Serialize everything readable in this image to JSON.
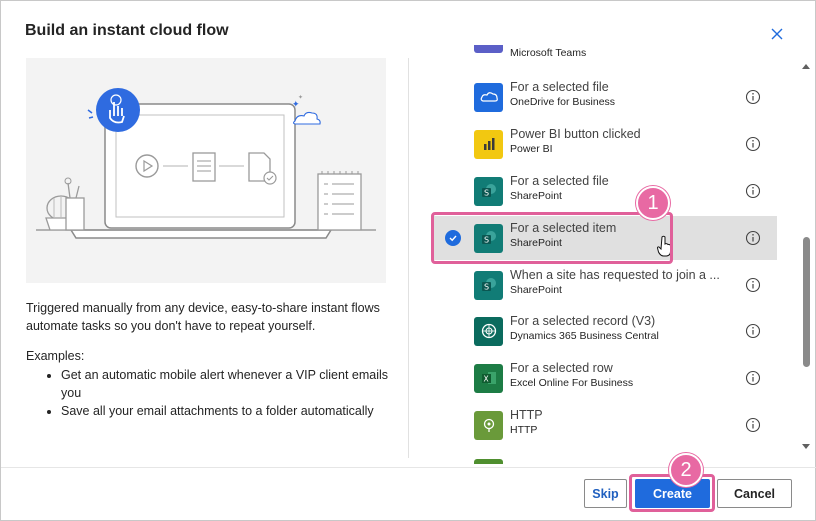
{
  "dialog": {
    "title": "Build an instant cloud flow",
    "close_icon": "close-icon"
  },
  "left": {
    "description": "Triggered manually from any device, easy-to-share instant flows automate tasks so you don't have to repeat yourself.",
    "examples_title": "Examples:",
    "examples": [
      "Get an automatic mobile alert whenever a VIP client emails you",
      "Save all your email attachments to a folder automatically"
    ]
  },
  "triggers": [
    {
      "title": "",
      "subtitle": "Microsoft Teams",
      "icon": "teams-icon",
      "color": "#5b5fc7",
      "partial": true
    },
    {
      "title": "For a selected file",
      "subtitle": "OneDrive for Business",
      "icon": "onedrive-icon",
      "color": "#1f6bdd"
    },
    {
      "title": "Power BI button clicked",
      "subtitle": "Power BI",
      "icon": "powerbi-icon",
      "color": "#f2c811"
    },
    {
      "title": "For a selected file",
      "subtitle": "SharePoint",
      "icon": "sharepoint-icon",
      "color": "#117c76"
    },
    {
      "title": "For a selected item",
      "subtitle": "SharePoint",
      "icon": "sharepoint-icon",
      "color": "#117c76",
      "selected": true
    },
    {
      "title": "When a site has requested to join a ...",
      "subtitle": "SharePoint",
      "icon": "sharepoint-icon",
      "color": "#117c76"
    },
    {
      "title": "For a selected record (V3)",
      "subtitle": "Dynamics 365 Business Central",
      "icon": "dynamics-icon",
      "color": "#0b6b5e"
    },
    {
      "title": "For a selected row",
      "subtitle": "Excel Online For Business",
      "icon": "excel-icon",
      "color": "#1d7c45"
    },
    {
      "title": "HTTP",
      "subtitle": "HTTP",
      "icon": "http-icon",
      "color": "#6a9a3a"
    },
    {
      "title": "",
      "subtitle": "",
      "icon": "",
      "color": "#4f8f2f",
      "partial": true
    }
  ],
  "buttons": {
    "skip": "Skip",
    "create": "Create",
    "cancel": "Cancel"
  },
  "annotations": {
    "step1": "1",
    "step2": "2",
    "accent": "#e869a3"
  }
}
